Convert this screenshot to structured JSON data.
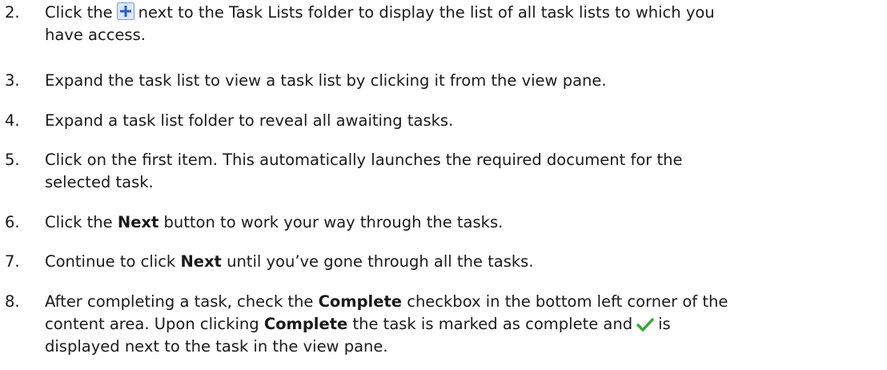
{
  "steps": [
    {
      "number": "2.",
      "lines": [
        {
          "before": "Click the",
          "icon": "plus-square-icon",
          "after": "next to the Task Lists folder to display the list of all task lists to which you"
        },
        {
          "text": "have access."
        }
      ]
    },
    {
      "number": "3.",
      "lines": [
        {
          "text": "Expand the task list to view a task list by clicking it from the view pane."
        }
      ]
    },
    {
      "number": "4.",
      "lines": [
        {
          "text": "Expand a task list folder to reveal all awaiting tasks."
        }
      ]
    },
    {
      "number": "5.",
      "lines": [
        {
          "text": "Click on the first item. This automatically launches the required document for the"
        },
        {
          "text": "selected task."
        }
      ]
    },
    {
      "number": "6.",
      "lines": [
        {
          "before": "Click the",
          "bold": "Next",
          "after": "button to work your way through the tasks."
        }
      ]
    },
    {
      "number": "7.",
      "lines": [
        {
          "before": "Continue to click",
          "bold": "Next",
          "after": "until you’ve gone through all the tasks."
        }
      ]
    },
    {
      "number": "8.",
      "lines": [
        {
          "before": "After completing a task, check the",
          "bold": "Complete",
          "after": "checkbox in the bottom left corner of the"
        },
        {
          "before": "content area. Upon clicking",
          "bold": "Complete",
          "after": "the task is marked as complete and",
          "icon": "checkmark-icon",
          "after2": "is"
        },
        {
          "text": "displayed next to the task in the view pane."
        }
      ]
    }
  ],
  "colors": {
    "text": "#1a1a1a",
    "plus_icon_fill": "#dbe8fb",
    "plus_icon_border": "#7a9cd3",
    "plus_icon_sign": "#2f5fb8",
    "check_color": "#3aa53a"
  }
}
